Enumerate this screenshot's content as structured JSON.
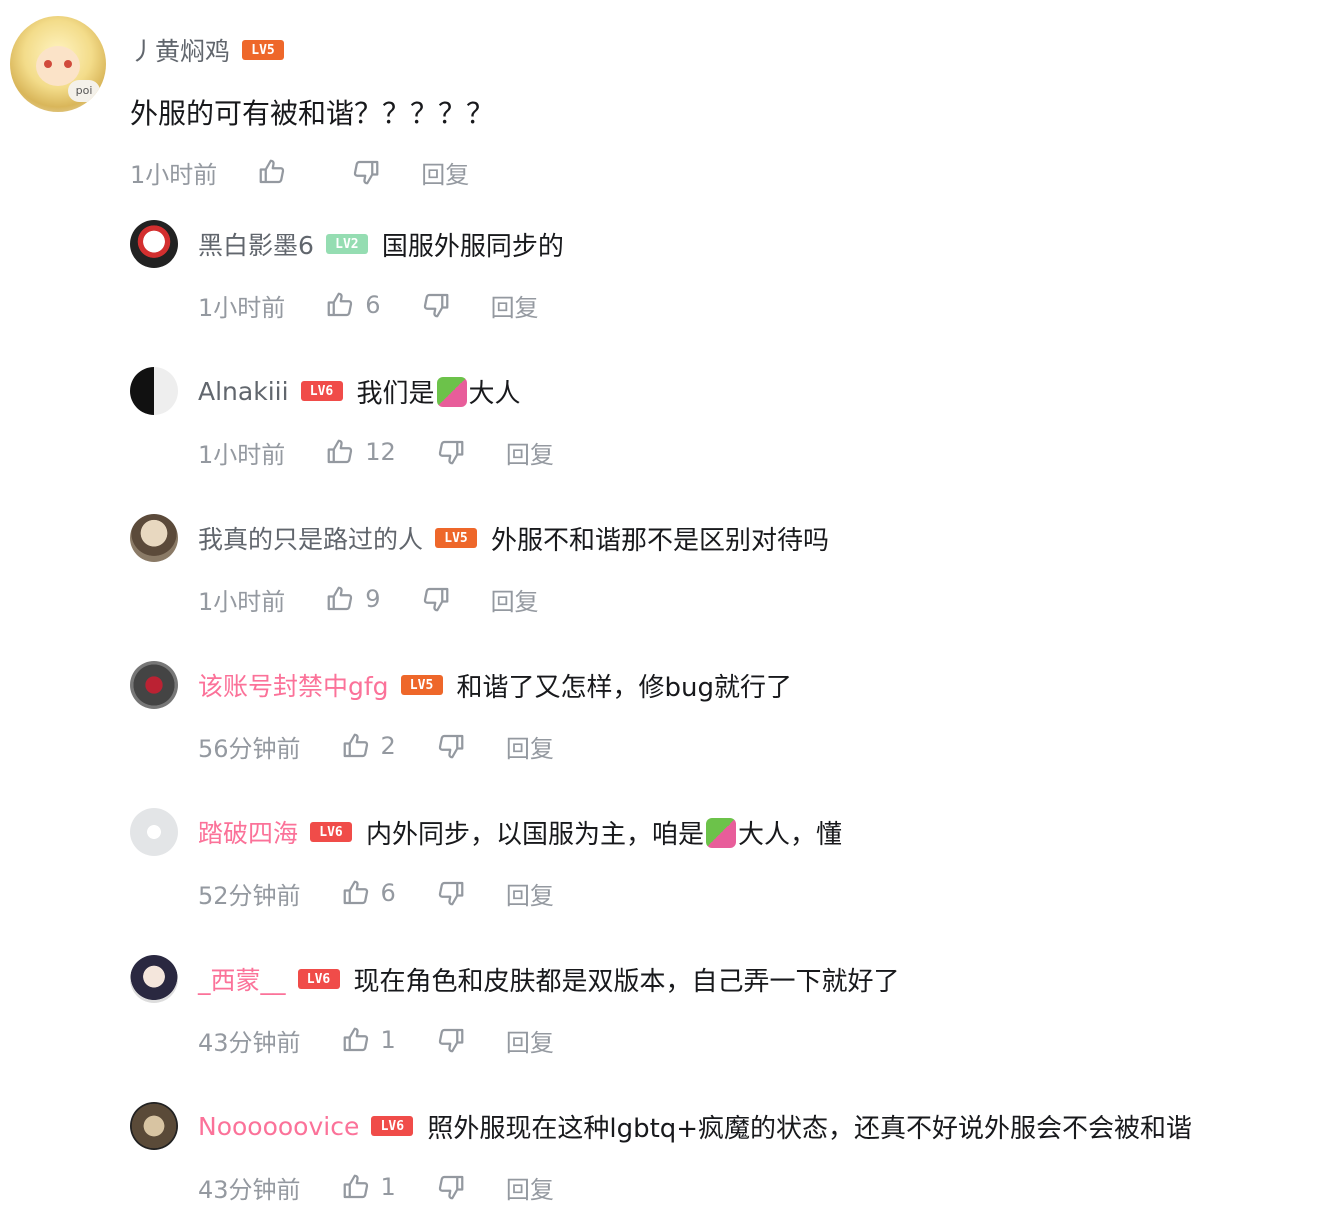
{
  "main_comment": {
    "username": "丿黄焖鸡",
    "level": "LV5",
    "content": "外服的可有被和谐？？？？？",
    "time": "1小时前",
    "likes": "",
    "reply_label": "回复"
  },
  "replies": [
    {
      "username": "黑白影墨6",
      "level": "LV2",
      "content": "国服外服同步的",
      "time": "1小时前",
      "likes": "6",
      "reply_label": "回复",
      "name_color": "gray"
    },
    {
      "username": "Alnakiii",
      "level": "LV6",
      "content_before": "我们是",
      "emoji": "dragon-emoji",
      "content_after": "大人",
      "time": "1小时前",
      "likes": "12",
      "reply_label": "回复",
      "name_color": "gray"
    },
    {
      "username": "我真的只是路过的人",
      "level": "LV5",
      "content": "外服不和谐那不是区别对待吗",
      "time": "1小时前",
      "likes": "9",
      "reply_label": "回复",
      "name_color": "gray"
    },
    {
      "username": "该账号封禁中gfg",
      "level": "LV5",
      "content": "和谐了又怎样，修bug就行了",
      "time": "56分钟前",
      "likes": "2",
      "reply_label": "回复",
      "name_color": "pink"
    },
    {
      "username": "踏破四海",
      "level": "LV6",
      "content_before": "内外同步，以国服为主，咱是",
      "emoji": "dragon-emoji",
      "content_after": "大人，懂",
      "time": "52分钟前",
      "likes": "6",
      "reply_label": "回复",
      "name_color": "pink"
    },
    {
      "username": "_西蒙__",
      "level": "LV6",
      "content": "现在角色和皮肤都是双版本，自己弄一下就好了",
      "time": "43分钟前",
      "likes": "1",
      "reply_label": "回复",
      "name_color": "pink"
    },
    {
      "username": "Noooooovice",
      "level": "LV6",
      "content": "照外服现在这种lgbtq+疯魔的状态，还真不好说外服会不会被和谐",
      "time": "43分钟前",
      "likes": "1",
      "reply_label": "回复",
      "name_color": "pink"
    }
  ],
  "colors": {
    "pink_name": "#fb7299",
    "gray_name": "#61666d",
    "meta": "#9499a0",
    "lv5": "#ee672a",
    "lv6": "#f04c49",
    "lv2": "#95ddb2"
  }
}
